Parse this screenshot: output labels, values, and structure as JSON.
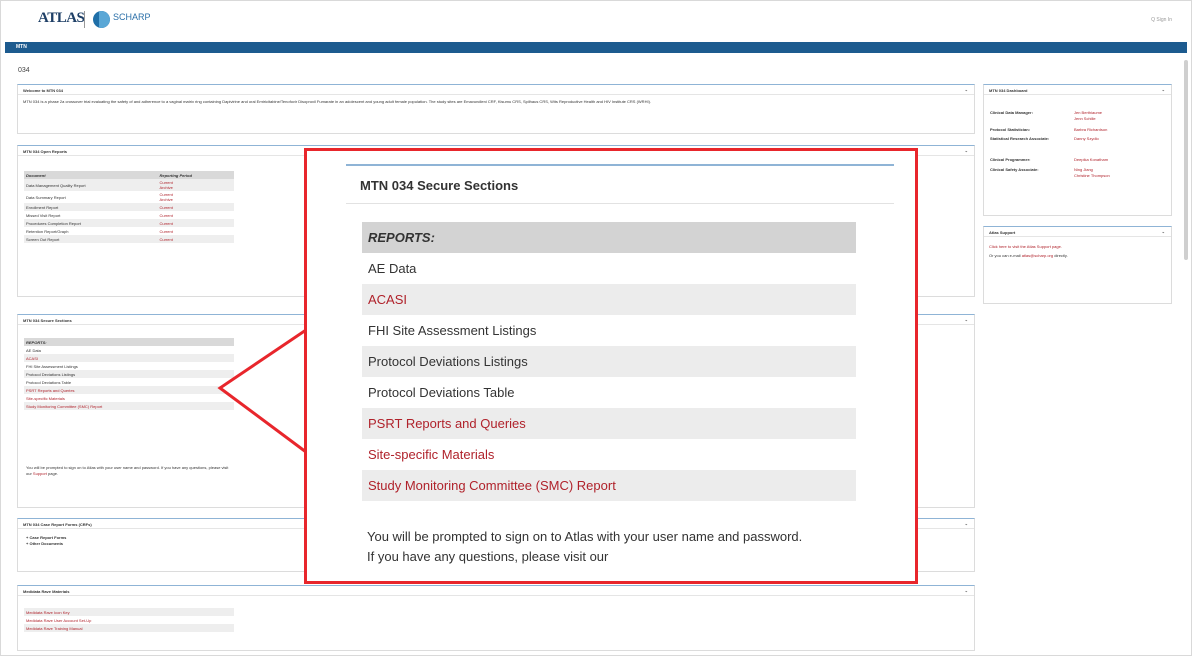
{
  "header": {
    "logo_text": "ATLAS",
    "partner_logo": "SCHARP",
    "sign_in": "Q Sign In",
    "nav_label": "MTN",
    "breadcrumb": "034"
  },
  "welcome": {
    "title": "Welcome to MTN 034",
    "text": "MTN 034 is a phase 2a crossover trial evaluating the safety of and adherence to a vaginal matrix ring containing Dapivirine and oral Emtricitabine/Tenofovir Disoproxil Fumarate in an adolescent and young adult female population. The study sites are Emavundleni CRF, Kisumu CRS, Spilhaus CRS, Wits Reproductive Health and HIV Institute CRS (WRHI)."
  },
  "open_reports": {
    "title": "MTN 034 Open Reports",
    "col_document": "Document",
    "col_period": "Reporting Period",
    "rows": [
      {
        "doc": "Data Management Quality Report",
        "p1": "Current",
        "p2": "Archive"
      },
      {
        "doc": "Data Summary Report",
        "p1": "Current",
        "p2": "Archive"
      },
      {
        "doc": "Enrollment Report",
        "p1": "Current",
        "p2": ""
      },
      {
        "doc": "Missed Visit Report",
        "p1": "Current",
        "p2": ""
      },
      {
        "doc": "Procedures Completion Report",
        "p1": "Current",
        "p2": ""
      },
      {
        "doc": "Retention Report/Graph",
        "p1": "Current",
        "p2": ""
      },
      {
        "doc": "Screen Out Report",
        "p1": "Current",
        "p2": ""
      }
    ]
  },
  "secure": {
    "title": "MTN 034 Secure Sections",
    "header": "REPORTS:",
    "items": [
      "AE Data",
      "ACASI",
      "FHI Site Assessment Listings",
      "Protocol Deviations Listings",
      "Protocol Deviations Table",
      "PSRT Reports and Queries",
      "Site-specific Materials",
      "Study Monitoring Committee (SMC) Report"
    ],
    "prompt": "You will be prompted to sign on to Atlas with your user name and password. If you have any questions, please visit our",
    "prompt_link": "Support",
    "prompt_end": " page.",
    "zoom_prompt": "You will be prompted to sign on to Atlas with your user name and password. If you have any questions, please visit our"
  },
  "crf": {
    "title": "MTN 034 Case Report Forms (CRFs)",
    "items": [
      "Case Report Forms",
      "Other Documents"
    ]
  },
  "medidata": {
    "title": "Medidata Rave Materials",
    "items": [
      "Medidata Rave Icon Key",
      "Medidata Rave User Account Set-Up",
      "Medidata Rave Training Manual"
    ]
  },
  "dashboard": {
    "title": "MTN 034 Dashboard",
    "rows": [
      {
        "role": "Clinical Data Manager:",
        "names": [
          "Jen Berthiaume",
          "Jenn Schille"
        ]
      },
      {
        "role": "Protocol Statistician:",
        "names": [
          "Barbra Richardson"
        ]
      },
      {
        "role": "Statistical Research Associate:",
        "names": [
          "Danny Szydlo"
        ]
      },
      {
        "role": "Clinical Programmer:",
        "names": [
          "Deepika Konatham"
        ]
      },
      {
        "role": "Clinical Safety Associate:",
        "names": [
          "Ning Jiang",
          "Christine Thompson"
        ]
      }
    ]
  },
  "support": {
    "title": "Atlas Support",
    "link": "Click here to visit the Atlas Support page.",
    "email_pre": "Or you can e-mail",
    "email": "atlas@scharp.org",
    "email_post": "directly."
  },
  "colors": {
    "accent": "#1d5b8f",
    "link": "#b0222b",
    "callout": "#e8262c"
  },
  "icons": [
    "chevron-down-icon",
    "search-icon"
  ]
}
